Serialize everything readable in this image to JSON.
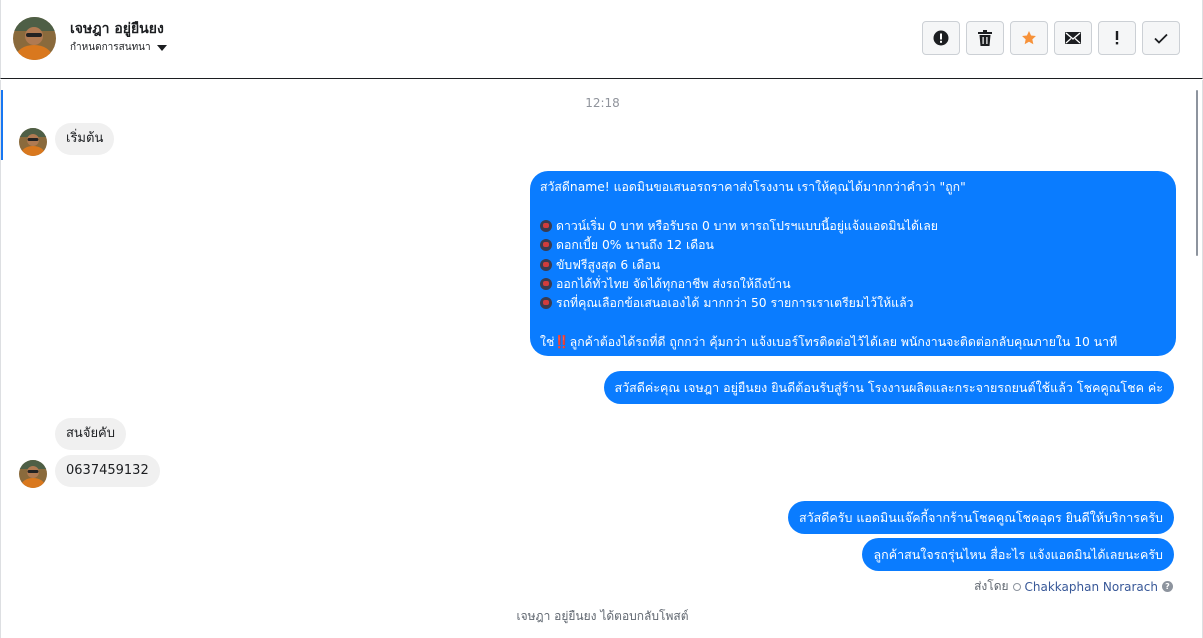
{
  "header": {
    "contact_name": "เจษฎา อยู่ยืนยง",
    "stage_label": "กำหนดการสนทนา",
    "toolbar": [
      {
        "name": "spam-button",
        "icon": "alert-circle-icon"
      },
      {
        "name": "delete-button",
        "icon": "trash-icon"
      },
      {
        "name": "star-button",
        "icon": "star-icon"
      },
      {
        "name": "mark-unread-button",
        "icon": "envelope-icon"
      },
      {
        "name": "follow-up-button",
        "icon": "exclamation-icon"
      },
      {
        "name": "mark-done-button",
        "icon": "check-icon"
      }
    ]
  },
  "thread": {
    "timestamp": "12:18",
    "messages": {
      "in_1": "เริ่มต้น",
      "out_1": {
        "line_1": "สวัสดีname! แอดมินขอเสนอรถราคาส่งโรงงาน เราให้คุณได้มากกว่าคำว่า \"ถูก\"",
        "line_2": "",
        "bullet_1": "ดาวน์เริ่ม 0 บาท หรือรับรถ 0 บาท หารถโปรฯแบบนี้อยู่แจ้งแอดมินได้เลย",
        "bullet_2": "ดอกเบี้ย 0% นานถึง 12 เดือน",
        "bullet_3": "ขับฟรีสูงสุด 6 เดือน",
        "bullet_4": "ออกได้ทั่วไทย จัดได้ทุกอาชีพ ส่งรถให้ถึงบ้าน",
        "bullet_5": "รถที่คุณเลือกข้อเสนอเองได้ มากกว่า 50 รายการเราเตรียมไว้ให้แล้ว",
        "closing_prefix": "ใช่",
        "closing_mark": "‼️",
        "closing_text": "ลูกค้าต้องได้รถที่ดี ถูกกว่า คุ้มกว่า แจ้งเบอร์โทรติดต่อไว้ได้เลย พนักงานจะติดต่อกลับคุณภายใน 10 นาที"
      },
      "out_2": "สวัสดีค่ะคุณ เจษฎา อยู่ยืนยง ยินดีต้อนรับสู่ร้าน โรงงานผลิตและกระจายรถยนต์ใช้แล้ว โชคคูณโชค ค่ะ",
      "in_2": "สนจัยคับ",
      "in_3": "0637459132",
      "out_3": "สวัสดีครับ แอดมินแจ๊คกี้จากร้านโชคคูณโชคอุดร ยินดีให้บริการครับ",
      "out_4": "ลูกค้าสนใจรถรุ่นไหน สื่อะไร แจ้งแอดมินได้เลยนะครับ"
    },
    "sent_by_label": "ส่งโดย",
    "sent_by_agent": "Chakkaphan Norarach",
    "system_note": "เจษฎา อยู่ยืนยง ได้ตอบกลับโพสต์"
  },
  "colors": {
    "outgoing_bubble": "#0a7cff",
    "incoming_bubble": "#f0f0f0",
    "star": "#f7923a"
  }
}
